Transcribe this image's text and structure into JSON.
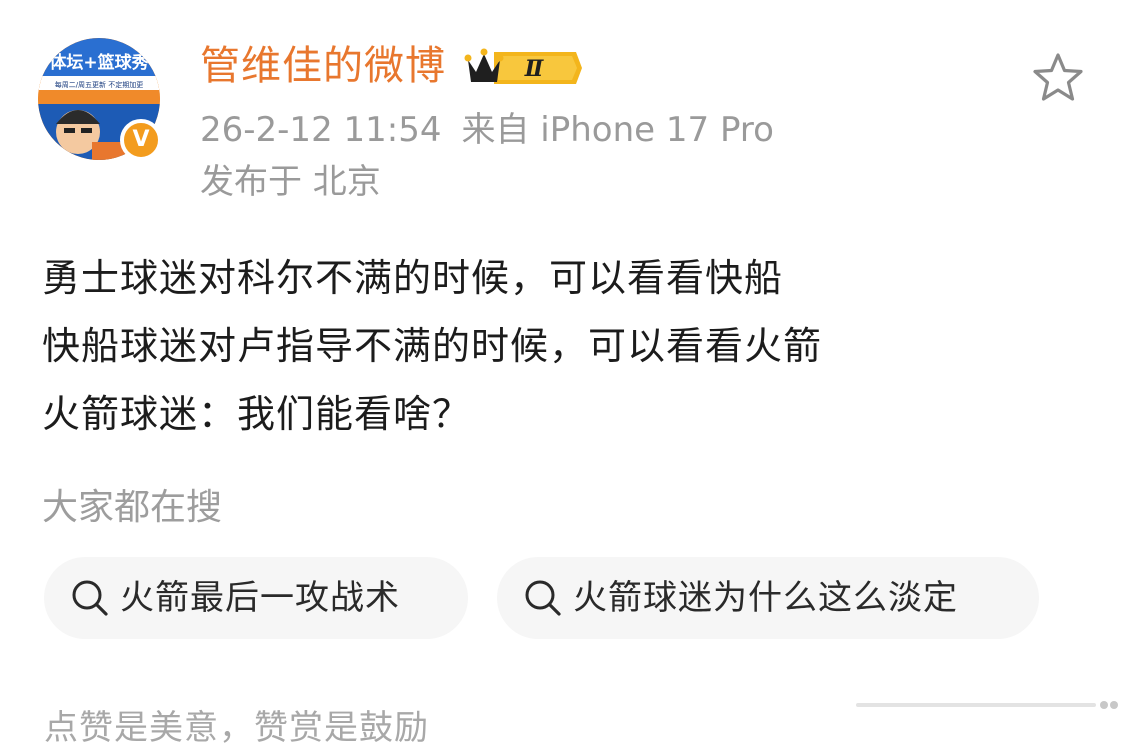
{
  "user": {
    "name": "管维佳的微博",
    "level_badge": "Ⅱ",
    "avatar_text_main": "体坛+篮球秀",
    "avatar_text_sub": "每周二/周五更新 不定期加更",
    "verified_mark": "V"
  },
  "meta": {
    "timestamp": "26-2-12 11:54",
    "source": "来自 iPhone 17 Pro",
    "location": "发布于 北京"
  },
  "post": {
    "lines": [
      "勇士球迷对科尔不满的时候，可以看看快船",
      "快船球迷对卢指导不满的时候，可以看看火箭",
      "火箭球迷：我们能看啥？"
    ]
  },
  "search": {
    "heading": "大家都在搜",
    "chips": [
      "火箭最后一攻战术",
      "火箭球迷为什么这么淡定"
    ]
  },
  "footer": {
    "text": "点赞是美意，赞赏是鼓励"
  },
  "colors": {
    "username": "#e8772e",
    "meta_gray": "#9a9a9a",
    "chip_bg": "#f6f6f6",
    "badge_gold": "#f3b51c",
    "verified_orange": "#f39c1e"
  },
  "icons": {
    "star": "star-outline-icon",
    "search": "search-icon",
    "crown": "crown-icon",
    "verified": "verified-icon",
    "more": "more-icon"
  }
}
